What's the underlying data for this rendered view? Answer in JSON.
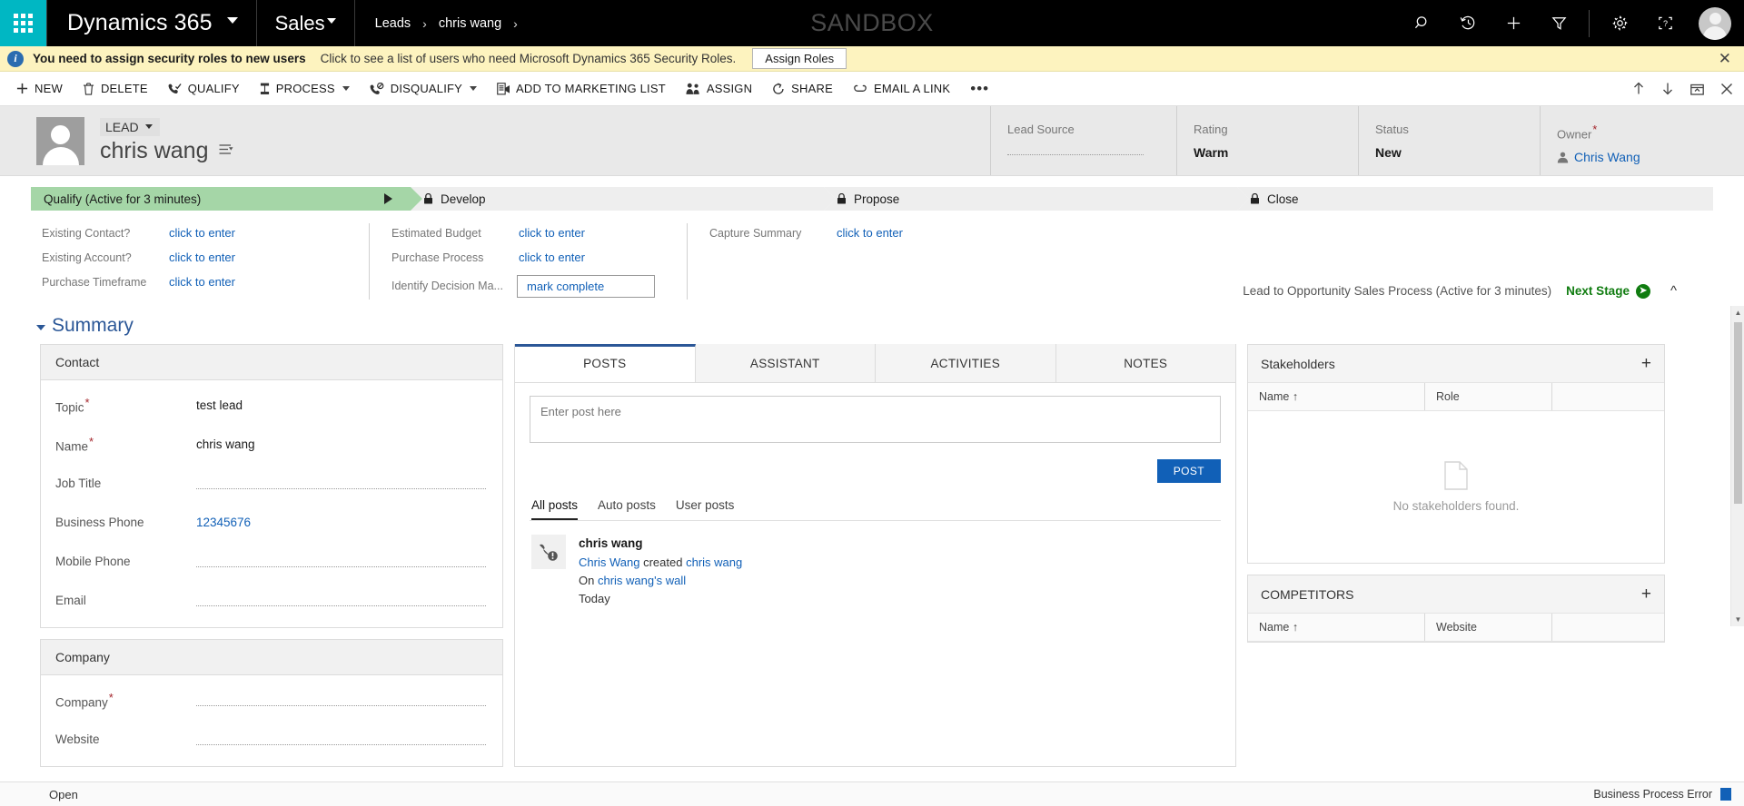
{
  "topnav": {
    "waffle": "app-launcher",
    "brand": "Dynamics 365",
    "area": "Sales",
    "breadcrumb": [
      "Leads",
      "chris wang"
    ],
    "breadcrumb_sep": "›",
    "watermark": "SANDBOX",
    "icons": [
      "search-icon",
      "recent-history-icon",
      "quick-create-icon",
      "advanced-find-icon",
      "settings-gear-icon",
      "help-icon",
      "user-avatar"
    ]
  },
  "notification": {
    "title": "You need to assign security roles to new users",
    "message": "Click to see a list of users who need Microsoft Dynamics 365 Security Roles.",
    "action_label": "Assign Roles",
    "close_label": "✕",
    "bg": "#fdf3bf"
  },
  "commandbar": {
    "items": [
      {
        "label": "NEW",
        "icon": "plus-icon",
        "caret": false
      },
      {
        "label": "DELETE",
        "icon": "trash-icon",
        "caret": false
      },
      {
        "label": "QUALIFY",
        "icon": "phone-check-icon",
        "caret": false
      },
      {
        "label": "PROCESS",
        "icon": "process-icon",
        "caret": true
      },
      {
        "label": "DISQUALIFY",
        "icon": "phone-block-icon",
        "caret": true
      },
      {
        "label": "ADD TO MARKETING LIST",
        "icon": "marketing-list-icon",
        "caret": false
      },
      {
        "label": "ASSIGN",
        "icon": "assign-people-icon",
        "caret": false
      },
      {
        "label": "SHARE",
        "icon": "share-icon",
        "caret": false
      },
      {
        "label": "EMAIL A LINK",
        "icon": "email-link-icon",
        "caret": false
      }
    ],
    "overflow": "•••",
    "right_icons": [
      "move-up-icon",
      "move-down-icon",
      "popout-icon",
      "close-icon"
    ]
  },
  "record_header": {
    "entity_type": "LEAD",
    "name": "chris wang",
    "flyout_icon": "form-selector-icon",
    "avatar": "lead-avatar",
    "fields": [
      {
        "label": "Lead Source",
        "value": "",
        "empty": true,
        "required": false
      },
      {
        "label": "Rating",
        "value": "Warm",
        "empty": false,
        "required": false
      },
      {
        "label": "Status",
        "value": "New",
        "empty": false,
        "required": false
      },
      {
        "label": "Owner",
        "value": "Chris Wang",
        "empty": false,
        "required": true,
        "link": true
      }
    ]
  },
  "bpf": {
    "stages": [
      {
        "label": "Qualify (Active for 3 minutes)",
        "active": true,
        "locked": false
      },
      {
        "label": "Develop",
        "active": false,
        "locked": true
      },
      {
        "label": "Propose",
        "active": false,
        "locked": true
      },
      {
        "label": "Close",
        "active": false,
        "locked": true
      }
    ],
    "groups": [
      {
        "fields": [
          {
            "label": "Existing Contact?",
            "value": "click to enter",
            "boxed": false
          },
          {
            "label": "Existing Account?",
            "value": "click to enter",
            "boxed": false
          },
          {
            "label": "Purchase Timeframe",
            "value": "click to enter",
            "boxed": false
          }
        ]
      },
      {
        "fields": [
          {
            "label": "Estimated Budget",
            "value": "click to enter",
            "boxed": false
          },
          {
            "label": "Purchase Process",
            "value": "click to enter",
            "boxed": false
          },
          {
            "label": "Identify Decision Ma...",
            "value": "mark complete",
            "boxed": true
          }
        ]
      },
      {
        "fields": [
          {
            "label": "Capture Summary",
            "value": "click to enter",
            "boxed": false
          }
        ]
      }
    ],
    "process_name": "Lead to Opportunity Sales Process (Active for 3 minutes)",
    "next_stage_label": "Next Stage",
    "next_stage_color": "#107c10",
    "collapse_icon": "chevron-up-icon"
  },
  "summary": {
    "title": "Summary",
    "contact_card": {
      "header": "Contact",
      "fields": [
        {
          "label": "Topic",
          "value": "test lead",
          "required": true,
          "empty": false,
          "link": false
        },
        {
          "label": "Name",
          "value": "chris wang",
          "required": true,
          "empty": false,
          "link": false
        },
        {
          "label": "Job Title",
          "value": "",
          "required": false,
          "empty": true,
          "link": false
        },
        {
          "label": "Business Phone",
          "value": "12345676",
          "required": false,
          "empty": false,
          "link": true
        },
        {
          "label": "Mobile Phone",
          "value": "",
          "required": false,
          "empty": true,
          "link": false
        },
        {
          "label": "Email",
          "value": "",
          "required": false,
          "empty": true,
          "link": false
        }
      ]
    },
    "company_card": {
      "header": "Company",
      "fields": [
        {
          "label": "Company",
          "value": "",
          "required": true,
          "empty": true,
          "link": false
        },
        {
          "label": "Website",
          "value": "",
          "required": false,
          "empty": true,
          "link": false
        }
      ]
    }
  },
  "social": {
    "tabs": [
      {
        "label": "POSTS",
        "selected": true
      },
      {
        "label": "ASSISTANT",
        "selected": false
      },
      {
        "label": "ACTIVITIES",
        "selected": false
      },
      {
        "label": "NOTES",
        "selected": false
      }
    ],
    "post_placeholder": "Enter post here",
    "post_button": "POST",
    "filters": [
      {
        "label": "All posts",
        "selected": true
      },
      {
        "label": "Auto posts",
        "selected": false
      },
      {
        "label": "User posts",
        "selected": false
      }
    ],
    "feed": [
      {
        "icon": "auto-post-phone-icon",
        "title": "chris wang",
        "line2_actor": "Chris Wang",
        "line2_verb": "created",
        "line2_target": "chris wang",
        "line3_prefix": "On",
        "line3_target": "chris wang's wall",
        "time": "Today"
      }
    ]
  },
  "rail": {
    "stakeholders": {
      "title": "Stakeholders",
      "add_icon": "plus-icon",
      "columns": [
        "Name ↑",
        "Role",
        ""
      ],
      "empty_text": "No stakeholders found."
    },
    "competitors": {
      "title": "COMPETITORS",
      "add_icon": "plus-icon",
      "columns": [
        "Name ↑",
        "Website",
        ""
      ],
      "empty_text": ""
    }
  },
  "statusbar": {
    "left": "Open",
    "right": "Business Process Error",
    "right_icon": "save-icon"
  }
}
